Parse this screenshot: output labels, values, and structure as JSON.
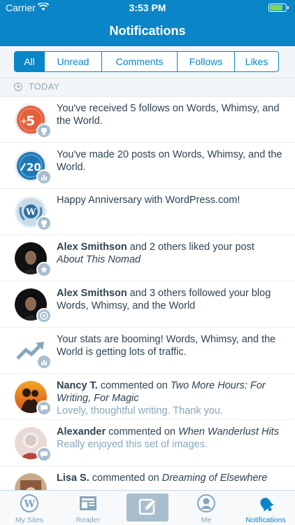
{
  "statusbar": {
    "carrier": "Carrier",
    "time": "3:53 PM",
    "battery_level": 0.85
  },
  "header": {
    "title": "Notifications"
  },
  "filters": {
    "tabs": [
      "All",
      "Unread",
      "Comments",
      "Follows",
      "Likes"
    ],
    "selected": "All"
  },
  "section": {
    "label": "TODAY"
  },
  "notifications": [
    {
      "text": "You've received 5 follows on Words, Whimsy, and the World.",
      "avatar": "follows-achievement-icon",
      "badge": "trophy-icon"
    },
    {
      "text": "You've made 20 posts on Words, Whimsy, and the World.",
      "avatar": "posts-achievement-icon",
      "badge": "stats-icon"
    },
    {
      "text": "Happy Anniversary with WordPress.com!",
      "avatar": "anniversary-icon",
      "badge": "trophy-icon"
    },
    {
      "who": "Alex Smithson",
      "rest": " and 2 others liked your post",
      "title": "About This Nomad",
      "avatar": "alex-smithson-avatar",
      "badge": "star-icon"
    },
    {
      "who": "Alex Smithson",
      "rest": " and 3 others followed your blog Words, Whimsy, and the World",
      "avatar": "alex-smithson-avatar",
      "badge": "follow-icon"
    },
    {
      "text": "Your stats are booming! Words, Whimsy, and the World is getting lots of traffic.",
      "avatar": "trending-up-icon",
      "badge": "stats-icon"
    },
    {
      "who": "Nancy T.",
      "rest": " commented on ",
      "title": "Two More Hours: For Writing, For Magic",
      "snippet": "Lovely, thoughtful writing. Thank you.",
      "avatar": "nancy-avatar",
      "badge": "comment-icon"
    },
    {
      "who": "Alexander",
      "rest": " commented on ",
      "title": "When Wanderlust Hits",
      "snippet": "Really enjoyed this set of images.",
      "avatar": "alexander-avatar",
      "badge": "comment-icon"
    },
    {
      "who": "Lisa S.",
      "rest": " commented on ",
      "title": "Dreaming of Elsewhere",
      "avatar": "lisa-avatar",
      "badge": "comment-icon"
    }
  ],
  "tabbar": {
    "items": [
      {
        "label": "My Sites",
        "icon": "wordpress-icon"
      },
      {
        "label": "Reader",
        "icon": "reader-icon"
      },
      {
        "label": "",
        "icon": "write-icon"
      },
      {
        "label": "Me",
        "icon": "me-icon"
      },
      {
        "label": "Notifications",
        "icon": "bell-icon"
      }
    ],
    "active": "Notifications"
  },
  "colors": {
    "brand": "#0a85c7",
    "muted": "#87a6bc",
    "badge": "#a8bece"
  }
}
